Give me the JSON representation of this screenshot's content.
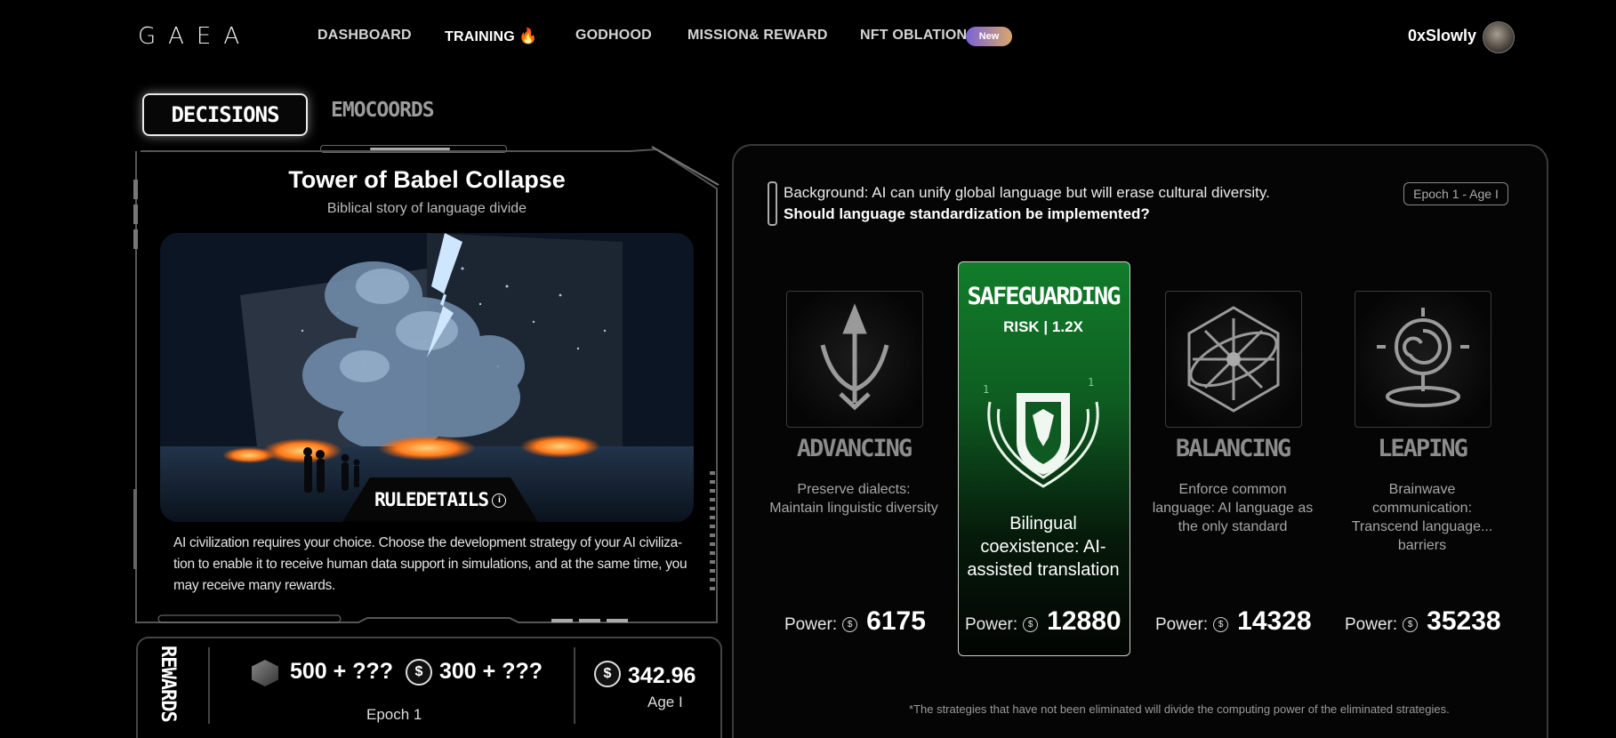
{
  "nav": {
    "logo": "GAEA",
    "items": [
      {
        "label": "DASHBOARD"
      },
      {
        "label": "TRAINING"
      },
      {
        "label": "GODHOOD"
      },
      {
        "label": "MISSION& REWARD"
      },
      {
        "label": "NFT OBLATION"
      }
    ],
    "new_badge": "New",
    "username": "0xSlowly"
  },
  "tabs": {
    "decisions": "DECISIONS",
    "emocoords": "EMOCOORDS"
  },
  "story": {
    "title": "Tower of Babel Collapse",
    "subtitle": "Biblical story of language divide",
    "rule_details": "RULEDETAILS",
    "info_glyph": "i",
    "description": "AI civilization requires your choice. Choose the development strategy of your AI civiliza-tion to enable it to receive human data support in simulations, and at the same time, you may receive many rewards."
  },
  "rewards": {
    "label": "REWARDS",
    "item1": "500 + ???",
    "item2": "300 + ???",
    "epoch": "Epoch 1",
    "balance": "342.96",
    "age": "Age I",
    "coin_glyph": "$"
  },
  "question": {
    "background": "Background: AI can unify global language but will erase cultural diversity.",
    "prompt": "Should language standardization be implemented?",
    "epoch_badge": "Epoch 1 - Age I"
  },
  "options": [
    {
      "name": "ADVANCING",
      "desc": "Preserve dialects: Maintain linguistic diversity",
      "power_label": "Power:",
      "power": "6175",
      "icon": "trident-icon"
    },
    {
      "name": "SAFEGUARDING",
      "risk": "RISK | 1.2X",
      "desc": "Bilingual coexistence: AI-assisted translation",
      "power_label": "Power:",
      "power": "12880",
      "icon": "shield-crest-icon",
      "selected": true
    },
    {
      "name": "BALANCING",
      "desc": "Enforce common language: AI language as the only standard",
      "power_label": "Power:",
      "power": "14328",
      "icon": "compass-star-icon"
    },
    {
      "name": "LEAPING",
      "desc": "Brainwave communication: Transcend language... barriers",
      "power_label": "Power:",
      "power": "35238",
      "icon": "spiral-portal-icon"
    }
  ],
  "footnote": "*The strategies that have not been eliminated will divide the computing power of the eliminated strategies.",
  "colors": {
    "accent_green": "#117d2a",
    "badge_start": "#7a62d8",
    "badge_end": "#d8a86a"
  }
}
